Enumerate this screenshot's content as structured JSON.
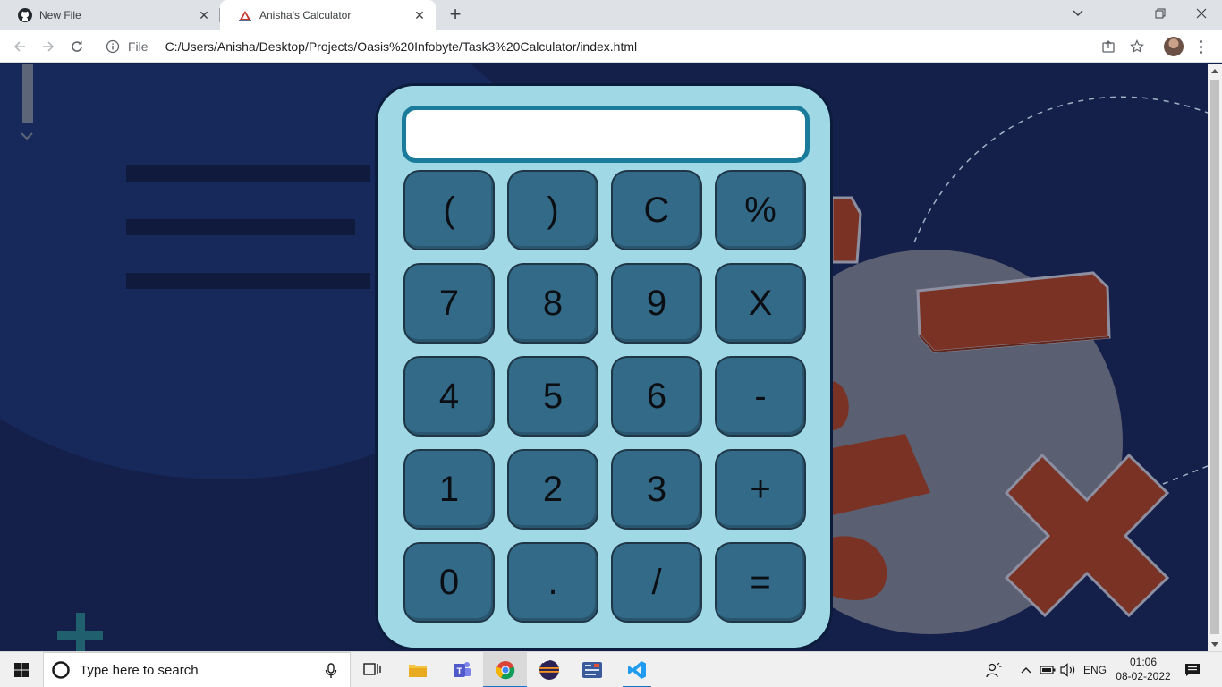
{
  "browser": {
    "tabs": [
      {
        "title": "New File",
        "icon": "github-icon"
      },
      {
        "title": "Anisha's Calculator",
        "icon": "calculator-favicon"
      }
    ],
    "address": {
      "scheme_label": "File",
      "url": "C:/Users/Anisha/Desktop/Projects/Oasis%20Infobyte/Task3%20Calculator/index.html"
    }
  },
  "calculator": {
    "display_value": "",
    "keys": [
      [
        "(",
        ")",
        "C",
        "%"
      ],
      [
        "7",
        "8",
        "9",
        "X"
      ],
      [
        "4",
        "5",
        "6",
        "-"
      ],
      [
        "1",
        "2",
        "3",
        "+"
      ],
      [
        "0",
        ".",
        "/",
        "="
      ]
    ]
  },
  "taskbar": {
    "search_placeholder": "Type here to search",
    "apps": [
      "task-view-icon",
      "file-explorer-icon",
      "teams-icon",
      "chrome-icon",
      "eclipse-icon",
      "control-panel-icon",
      "vscode-icon"
    ],
    "tray": {
      "language": "ENG",
      "time": "01:06",
      "date": "08-02-2022"
    }
  },
  "colors": {
    "page_background": "#141f4a",
    "calculator_body": "#a0d8e6",
    "display_border": "#1b7b9b",
    "key_fill": "#336a87",
    "decor_shape": "#7a3224"
  }
}
